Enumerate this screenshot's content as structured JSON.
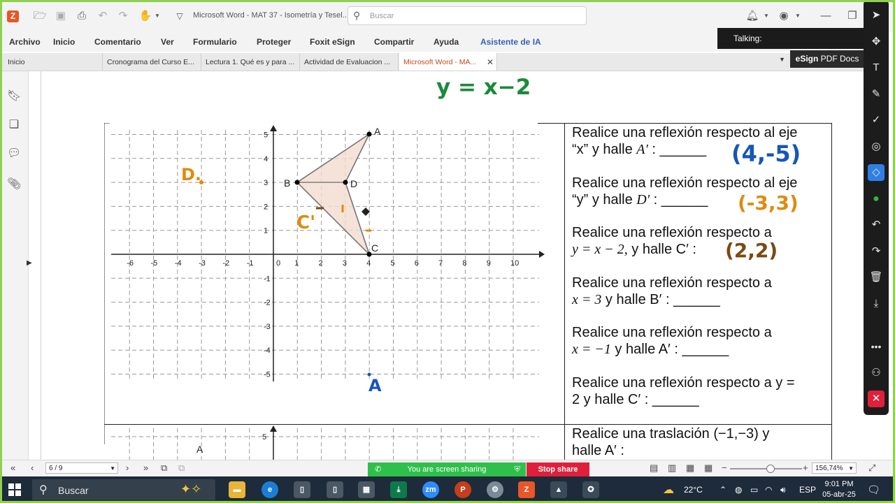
{
  "window": {
    "title": "Microsoft Word - MAT 37 - Isometría y Tesel...",
    "search_placeholder": "Buscar"
  },
  "menu": [
    "Archivo",
    "Inicio",
    "Comentario",
    "Ver",
    "Formulario",
    "Proteger",
    "Foxit eSign",
    "Compartir",
    "Ayuda",
    "Asistente de IA"
  ],
  "tabs": [
    {
      "label": "Inicio"
    },
    {
      "label": "Cronograma del Curso E..."
    },
    {
      "label": "Lectura 1. Qué es y para ..."
    },
    {
      "label": "Actividad de Evaluacion ..."
    },
    {
      "label": "Microsoft Word - MA...",
      "close": "✕"
    }
  ],
  "overlay": {
    "talking": "Talking:",
    "esign_bold": "eSign",
    "esign_rest": " PDF Docs"
  },
  "document": {
    "handwritten_equation": "y = x−2",
    "graph_top": {
      "x_ticks": [
        "-6",
        "-5",
        "-4",
        "-3",
        "-2",
        "-1",
        "0",
        "1",
        "2",
        "3",
        "4",
        "5",
        "6",
        "7",
        "8",
        "9",
        "10"
      ],
      "y_ticks": [
        "5",
        "4",
        "3",
        "2",
        "1",
        "-1",
        "-2",
        "-3",
        "-4",
        "-5"
      ],
      "point_labels": {
        "A": "A",
        "B": "B",
        "C": "C",
        "D": "D"
      },
      "handwritten": {
        "D": "D.",
        "C_prime": "C'",
        "A": "A"
      }
    },
    "graph_bottom": {
      "y_tick": "5",
      "point_label": "A"
    },
    "questions": [
      {
        "line1": "Realice una reflexión respecto al eje",
        "line2_pre": "“x” y halle ",
        "var": "A′",
        "line2_post": " : ______",
        "answer": "(4,-5)"
      },
      {
        "line1": "Realice una reflexión respecto al eje",
        "line2_pre": "“y” y halle ",
        "var": "D′",
        "line2_post": " : ______",
        "answer": "(-3,3)"
      },
      {
        "line1": "Realice una reflexión respecto a",
        "line2_pre": "y = x − 2,",
        "var": "  y halle C′",
        "line2_post": " :",
        "answer": "(2,2)"
      },
      {
        "line1": "Realice una reflexión respecto a",
        "line2_pre": "x = 3",
        "var": "  y halle B′",
        "line2_post": " : ______",
        "answer": ""
      },
      {
        "line1": "Realice una reflexión respecto a",
        "line2_pre": "x = −1",
        "var": "  y halle A′",
        "line2_post": " : ______",
        "answer": ""
      },
      {
        "line1": "Realice una reflexión respecto a  y =",
        "line2_pre": "2",
        "var": "  y halle C′",
        "line2_post": " : ______",
        "answer": ""
      },
      {
        "line1": "Realice una traslación (−1,−3)  y",
        "line2_pre": "halle A′",
        "var": "",
        "line2_post": " :",
        "answer": ""
      }
    ]
  },
  "status": {
    "page": "6 / 9",
    "sharing": "You are screen sharing",
    "stop_share": "Stop share",
    "zoom": "156,74%"
  },
  "taskbar": {
    "search": "Buscar",
    "temperature": "22°C",
    "language": "ESP",
    "time": "9:01 PM",
    "date": "05-abr-25"
  },
  "colors": {
    "accent": "#e8562a",
    "hw_green": "#1a8a3a",
    "hw_blue": "#1656b8",
    "hw_orange": "#e08a10",
    "hw_brown": "#7a4a10",
    "share_green": "#2fc04b",
    "stop_red": "#e0203a"
  }
}
